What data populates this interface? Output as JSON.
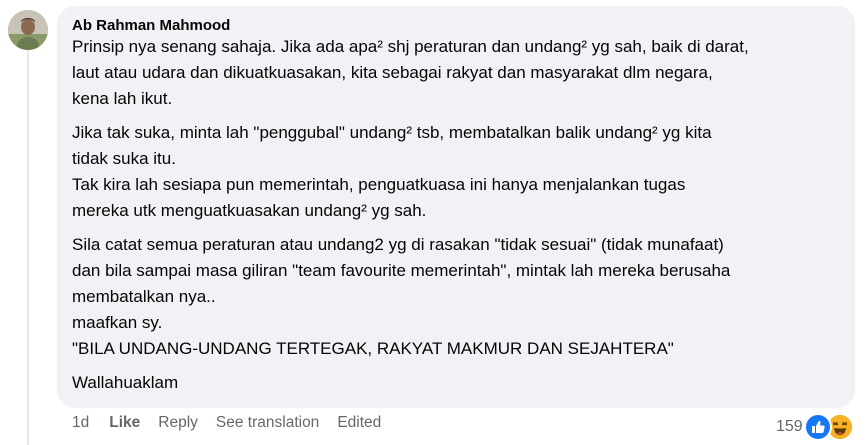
{
  "comment": {
    "author": "Ab Rahman Mahmood",
    "paragraphs": [
      [
        "Prinsip nya senang sahaja. Jika ada apa² shj peraturan dan undang² yg sah, baik di darat,",
        "laut atau udara dan dikuatkuasakan, kita sebagai rakyat dan masyarakat dlm negara,",
        "kena lah ikut."
      ],
      [
        "Jika tak suka, minta lah \"penggubal\" undang² tsb, membatalkan balik undang² yg kita",
        "tidak suka itu.",
        "Tak kira lah sesiapa pun memerintah, penguatkuasa ini hanya menjalankan tugas",
        "mereka utk menguatkuasakan undang² yg sah."
      ],
      [
        "Sila catat semua peraturan atau undang2 yg di rasakan \"tidak sesuai\" (tidak munafaat)",
        "dan bila sampai masa giliran \"team favourite memerintah\", mintak lah mereka berusaha",
        "membatalkan nya..",
        "maafkan sy.",
        "\"BILA UNDANG-UNDANG TERTEGAK, RAKYAT MAKMUR DAN SEJAHTERA\""
      ],
      [
        "Wallahuaklam"
      ]
    ]
  },
  "actions": {
    "time": "1d",
    "like": "Like",
    "reply": "Reply",
    "translate": "See translation",
    "edited": "Edited"
  },
  "reactions": {
    "count": "159",
    "icons": [
      "like-icon",
      "laugh-icon"
    ],
    "colors": {
      "like": "#1877f2",
      "laugh": "#f7b125"
    }
  }
}
